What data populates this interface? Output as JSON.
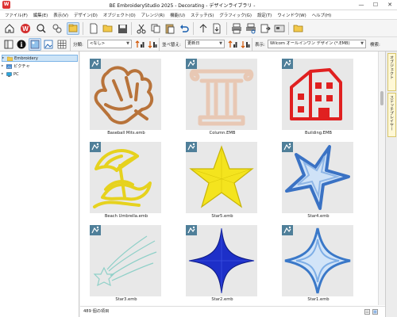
{
  "window": {
    "title": "BE EmbroideryStudio 2025 - Decorating - デザインライブラリ -",
    "app_icon": "W"
  },
  "menu": [
    "ファイル(F)",
    "編集(E)",
    "表示(V)",
    "デザイン(D)",
    "オブジェクト(O)",
    "アレンジ(R)",
    "機能(U)",
    "ステッチ(S)",
    "グラフィック(G)",
    "設定(T)",
    "ウィンドウ(W)",
    "ヘルプ(H)"
  ],
  "toolbar2": {
    "group_label": "分類:",
    "group_value": "<なし>",
    "sort_label": "並べ替え:",
    "sort_value": "更新日",
    "display_label": "表示:",
    "display_value": "Wilcom オールインワン デザイン (*.EMB)",
    "search_label": "検索:"
  },
  "tree": [
    {
      "label": "Embroidery",
      "selected": true
    },
    {
      "label": "ピクチャ",
      "selected": false
    },
    {
      "label": "PC",
      "selected": false
    }
  ],
  "designs": [
    {
      "name": "Baseball Mits.emb",
      "art": "mitt"
    },
    {
      "name": "Column.EMB",
      "art": "column"
    },
    {
      "name": "Building.EMB",
      "art": "building"
    },
    {
      "name": "Beach Umbrella.emb",
      "art": "umbrella"
    },
    {
      "name": "Star5.emb",
      "art": "star5"
    },
    {
      "name": "Star4.emb",
      "art": "star4"
    },
    {
      "name": "Star3.emb",
      "art": "star3"
    },
    {
      "name": "Star2.emb",
      "art": "star2"
    },
    {
      "name": "Star1.emb",
      "art": "star1"
    }
  ],
  "status": {
    "count_text": "489 個の項目"
  },
  "side_tabs": [
    "オブジェクト",
    "ステッチプレイヤー"
  ],
  "colors": {
    "selected_bg": "#cde4f7",
    "thumb_bg": "#e8e8e8"
  }
}
